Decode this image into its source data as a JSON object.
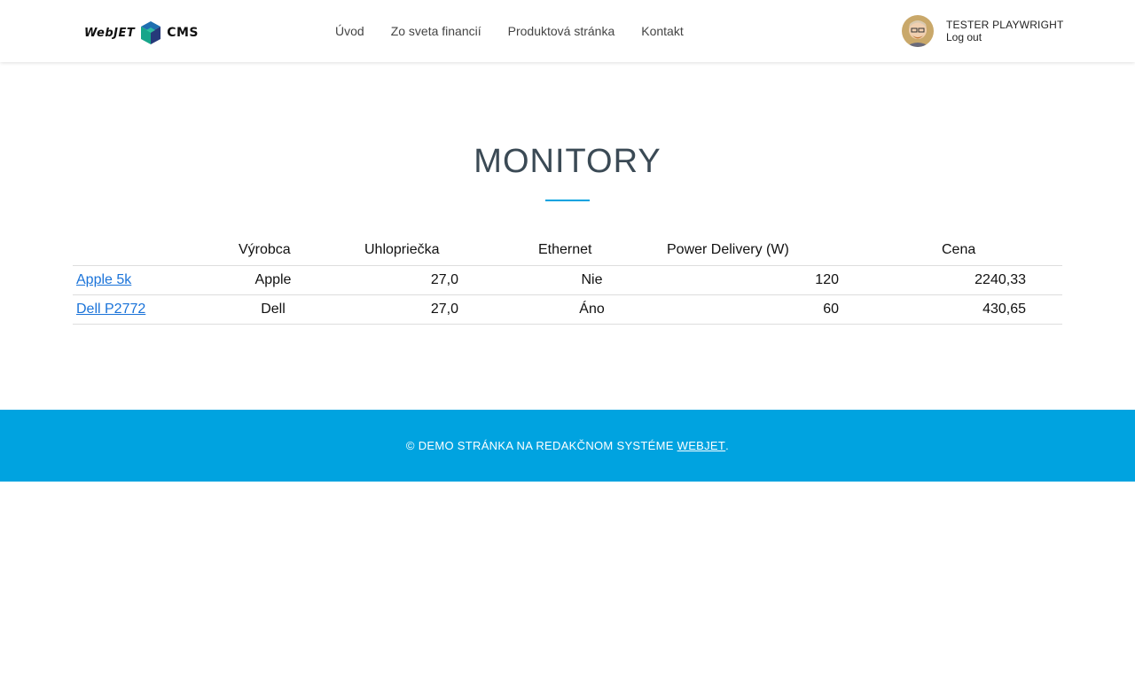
{
  "header": {
    "logo": {
      "text_left": "WebJET",
      "text_right": "CMS"
    },
    "nav": [
      {
        "label": "Úvod"
      },
      {
        "label": "Zo sveta financií"
      },
      {
        "label": "Produktová stránka"
      },
      {
        "label": "Kontakt"
      }
    ],
    "user": {
      "name": "TESTER PLAYWRIGHT",
      "logout_label": "Log out"
    }
  },
  "main": {
    "title": "MONITORY",
    "table": {
      "columns": [
        "",
        "Výrobca",
        "Uhlopriečka",
        "Ethernet",
        "Power Delivery (W)",
        "Cena"
      ],
      "rows": [
        {
          "name": "Apple 5k",
          "vyrobca": "Apple",
          "uhlopriecka": "27,0",
          "ethernet": "Nie",
          "power_delivery": "120",
          "cena": "2240,33"
        },
        {
          "name": "Dell P2772",
          "vyrobca": "Dell",
          "uhlopriecka": "27,0",
          "ethernet": "Áno",
          "power_delivery": "60",
          "cena": "430,65"
        }
      ]
    }
  },
  "footer": {
    "text": "© DEMO STRÁNKA NA REDAKČNOM SYSTÉME",
    "link_label": "WEBJET",
    "suffix": "."
  },
  "colors": {
    "accent": "#00a3e0",
    "title": "#3b4a55",
    "link": "#1a73d9"
  }
}
